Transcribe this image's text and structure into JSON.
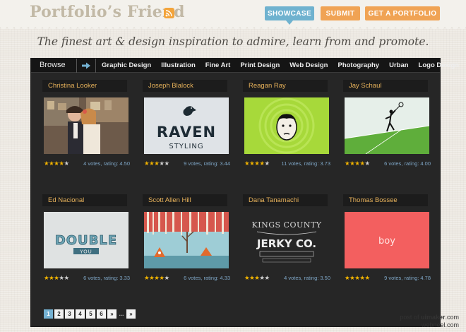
{
  "brand": {
    "logo": "Portfolio’s Friend",
    "rss_icon": "rss-icon"
  },
  "nav": {
    "showcase": "SHOWCASE",
    "submit": "SUBMIT",
    "get_portfolio": "GET A PORTFOLIO"
  },
  "tagline": "The finest art & design inspiration to admire, learn from and promote.",
  "browse": {
    "label": "Browse",
    "categories": [
      "Graphic Design",
      "Illustration",
      "Fine Art",
      "Print Design",
      "Web Design",
      "Photography",
      "Urban",
      "Logo Design"
    ]
  },
  "cards": [
    {
      "name": "Christina Looker",
      "votes": "4 votes, rating: 4.50",
      "rating": 4.5
    },
    {
      "name": "Joseph Blalock",
      "votes": "9 votes, rating: 3.44",
      "rating": 3.44,
      "thumb_title": "RAVEN",
      "thumb_sub": "STYLING"
    },
    {
      "name": "Reagan Ray",
      "votes": "11 votes, rating: 3.73",
      "rating": 3.73
    },
    {
      "name": "Jay Schaul",
      "votes": "6 votes, rating: 4.00",
      "rating": 4.0
    },
    {
      "name": "Ed Nacional",
      "votes": "6 votes, rating: 3.33",
      "rating": 3.33,
      "thumb_title": "DOUBLE",
      "thumb_sub": "YOU"
    },
    {
      "name": "Scott Allen Hill",
      "votes": "6 votes, rating: 4.33",
      "rating": 4.33
    },
    {
      "name": "Dana Tanamachi",
      "votes": "4 votes, rating: 3.50",
      "rating": 3.5,
      "thumb_title": "JERKY CO.",
      "thumb_sub": "KINGS COUNTY"
    },
    {
      "name": "Thomas Bossee",
      "votes": "9 votes, rating: 4.78",
      "rating": 4.78,
      "thumb_title": "boy"
    }
  ],
  "pagination": [
    "1",
    "2",
    "3",
    "4",
    "5",
    "6",
    "»",
    "...",
    "»"
  ],
  "watermark": {
    "line1_prefix": "post of ",
    "line1_brand": "uimaker",
    "line1_suffix": ".com",
    "line2": "webneel.com"
  },
  "colors": {
    "accent_blue": "#6fb2cf",
    "accent_orange": "#f0a354",
    "name_gold": "#e6b15a",
    "star": "#f2b400"
  }
}
